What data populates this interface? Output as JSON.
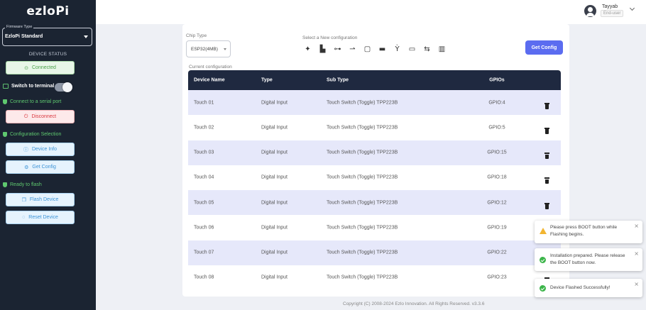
{
  "app": {
    "logo": "ezloPi"
  },
  "sidebar": {
    "firmware_legend": "Firmware Type",
    "firmware_value": "EzloPi Standard",
    "device_status": "DEVICE STATUS",
    "connected_label": "Connected",
    "switch_terminal_label": "Switch to terminal",
    "connect_serial_label": "Connect to a serial port",
    "disconnect_label": "Disconnect",
    "config_selection_label": "Configuration Selection",
    "device_info_label": "Device Info",
    "get_config_label": "Get Config",
    "ready_flash_label": "Ready to flash",
    "flash_device_label": "Flash Device",
    "reset_device_label": "Reset Device"
  },
  "user": {
    "name": "Tayyab",
    "role": "End-user"
  },
  "main": {
    "chip_type_label": "Chip Type",
    "chip_type_value": "ESP32(4MB)",
    "new_config_label": "Select a New configuration",
    "get_config_button": "Get Config",
    "current_config_label": "Current configuration",
    "columns": [
      "Device Name",
      "Type",
      "Sub Type",
      "GPIOs"
    ],
    "rows": [
      {
        "name": "Touch 01",
        "type": "Digital Input",
        "subtype": "Touch Switch (Toggle) TPP223B",
        "gpio": "GPIO:4"
      },
      {
        "name": "Touch 02",
        "type": "Digital Input",
        "subtype": "Touch Switch (Toggle) TPP223B",
        "gpio": "GPIO:5"
      },
      {
        "name": "Touch 03",
        "type": "Digital Input",
        "subtype": "Touch Switch (Toggle) TPP223B",
        "gpio": "GPIO:15"
      },
      {
        "name": "Touch 04",
        "type": "Digital Input",
        "subtype": "Touch Switch (Toggle) TPP223B",
        "gpio": "GPIO:18"
      },
      {
        "name": "Touch 05",
        "type": "Digital Input",
        "subtype": "Touch Switch (Toggle) TPP223B",
        "gpio": "GPIO:12"
      },
      {
        "name": "Touch 06",
        "type": "Digital Input",
        "subtype": "Touch Switch (Toggle) TPP223B",
        "gpio": "GPIO:19"
      },
      {
        "name": "Touch 07",
        "type": "Digital Input",
        "subtype": "Touch Switch (Toggle) TPP223B",
        "gpio": "GPIO:22"
      },
      {
        "name": "Touch 08",
        "type": "Digital Input",
        "subtype": "Touch Switch (Toggle) TPP223B",
        "gpio": "GPIO:23"
      }
    ]
  },
  "footer": {
    "text": "Copyright (C) 2008-2024 Ezlo Innovation. All Rights Reserved. v3.3.6"
  },
  "toasts": [
    {
      "kind": "warning",
      "text": "Please press BOOT button while Flashing begins."
    },
    {
      "kind": "success",
      "text": "Installation prepared. Please release the BOOT button now."
    },
    {
      "kind": "success",
      "text": "Device Flashed Successfully!"
    }
  ],
  "toast_close_glyph": "×",
  "config_icons": [
    "✦",
    "▙",
    "⊶",
    "⇀",
    "▢",
    "▬",
    "Ỳ",
    "▭",
    "⇆",
    "▥"
  ],
  "colors": {
    "sidebar_bg": "#1b2432",
    "accent": "#5b6cf0",
    "table_header": "#1f2940",
    "row_alt": "#e6e8fa",
    "success": "#5fc86f",
    "danger": "#d9363e"
  }
}
